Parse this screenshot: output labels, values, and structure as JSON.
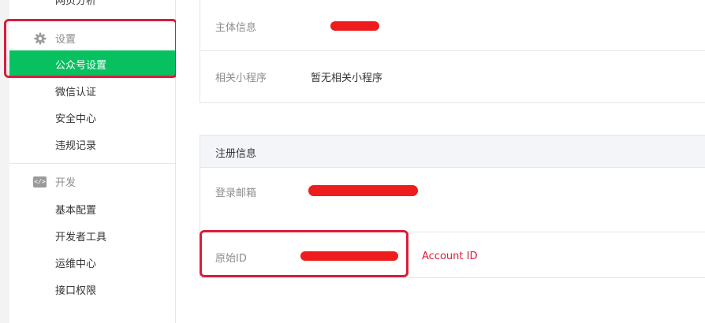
{
  "sidebar": {
    "clipped_item": "网页分析",
    "settings_group": {
      "label": "设置",
      "icon": "gear-icon"
    },
    "settings_items": [
      {
        "label": "公众号设置",
        "active": true
      },
      {
        "label": "微信认证"
      },
      {
        "label": "安全中心"
      },
      {
        "label": "违规记录"
      }
    ],
    "dev_group": {
      "label": "开发",
      "icon": "code-icon"
    },
    "dev_items": [
      {
        "label": "基本配置"
      },
      {
        "label": "开发者工具"
      },
      {
        "label": "运维中心"
      },
      {
        "label": "接口权限"
      }
    ]
  },
  "account_info": {
    "subject_label": "主体信息",
    "subject_value": "",
    "miniprogram_label": "相关小程序",
    "miniprogram_value": "暂无相关小程序"
  },
  "registration": {
    "title": "注册信息",
    "email_label": "登录邮箱",
    "email_value": "",
    "original_id_label": "原始ID",
    "original_id_value": "",
    "annotation": "Account ID"
  },
  "colors": {
    "accent": "#07c160",
    "highlight": "#d81e3c",
    "redaction": "#ee1c1c"
  }
}
